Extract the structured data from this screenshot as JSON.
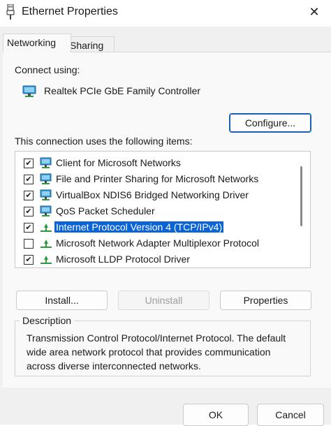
{
  "window": {
    "title": "Ethernet Properties",
    "close_symbol": "✕"
  },
  "tabs": [
    {
      "label": "Networking",
      "active": true
    },
    {
      "label": "Sharing",
      "active": false
    }
  ],
  "connect_using": {
    "label": "Connect using:",
    "adapter": "Realtek PCIe GbE Family Controller",
    "adapter_icon": "network-adapter-icon"
  },
  "configure_button": "Configure...",
  "items_label": "This connection uses the following items:",
  "items": [
    {
      "label": "Client for Microsoft Networks",
      "checked": true,
      "icon": "network-client-icon",
      "selected": false
    },
    {
      "label": "File and Printer Sharing for Microsoft Networks",
      "checked": true,
      "icon": "network-service-icon",
      "selected": false
    },
    {
      "label": "VirtualBox NDIS6 Bridged Networking Driver",
      "checked": true,
      "icon": "network-service-icon",
      "selected": false
    },
    {
      "label": "QoS Packet Scheduler",
      "checked": true,
      "icon": "network-service-icon",
      "selected": false
    },
    {
      "label": "Internet Protocol Version 4 (TCP/IPv4)",
      "checked": true,
      "icon": "protocol-icon",
      "selected": true
    },
    {
      "label": "Microsoft Network Adapter Multiplexor Protocol",
      "checked": false,
      "icon": "protocol-icon",
      "selected": false
    },
    {
      "label": "Microsoft LLDP Protocol Driver",
      "checked": true,
      "icon": "protocol-icon",
      "selected": false
    }
  ],
  "buttons": {
    "install": "Install...",
    "uninstall": "Uninstall",
    "properties": "Properties",
    "ok": "OK",
    "cancel": "Cancel"
  },
  "description": {
    "legend": "Description",
    "text": "Transmission Control Protocol/Internet Protocol. The default wide area network protocol that provides communication across diverse interconnected networks."
  },
  "colors": {
    "selection": "#0a64d6",
    "primary_border": "#1b5fb3"
  }
}
